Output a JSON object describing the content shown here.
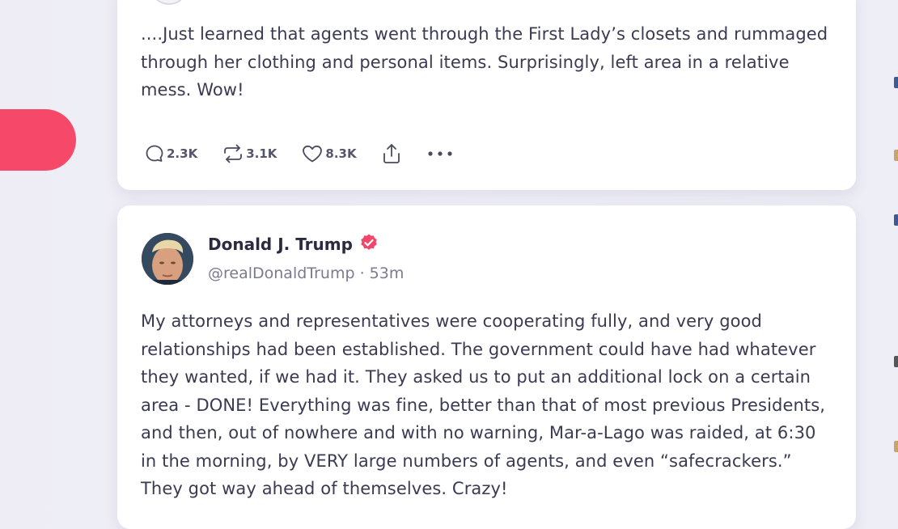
{
  "colors": {
    "accent": "#f6496a",
    "card_bg": "#ffffff",
    "page_bg": "#efeef7",
    "verified": "#f0476a"
  },
  "posts": [
    {
      "text": "....Just learned that agents went through the First Lady’s closets and rummaged through her clothing and personal items. Surprisingly, left area in a relative mess. Wow!",
      "actions": {
        "replies": "2.3K",
        "reposts": "3.1K",
        "likes": "8.3K"
      },
      "icons": [
        "reply-icon",
        "repost-icon",
        "heart-icon",
        "share-icon",
        "more-icon"
      ]
    },
    {
      "author": {
        "name": "Donald J. Trump",
        "handle": "@realDonaldTrump",
        "separator": "·",
        "time": "53m",
        "verified_icon": "verified-badge-icon"
      },
      "text": "My attorneys and representatives were cooperating fully, and very good relationships had been established. The government could have had whatever they wanted, if we had it. They asked us to put an additional lock on a certain area - DONE! Everything was fine, better than that of most previous Presidents, and then, out of nowhere and with no warning, Mar-a-Lago was raided, at 6:30 in the morning, by VERY large numbers of agents, and even “safecrackers.” They got way ahead of themselves. Crazy!"
    }
  ]
}
